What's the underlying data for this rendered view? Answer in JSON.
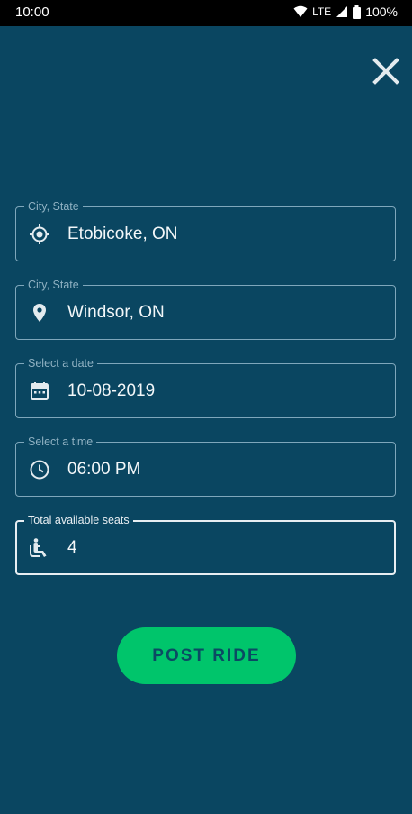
{
  "status_bar": {
    "time": "10:00",
    "network": "LTE",
    "battery": "100%"
  },
  "form": {
    "fields": [
      {
        "label": "City, State",
        "value": "Etobicoke, ON",
        "icon": "my-location-icon"
      },
      {
        "label": "City, State",
        "value": "Windsor, ON",
        "icon": "location-pin-icon"
      },
      {
        "label": "Select a date",
        "value": "10-08-2019",
        "icon": "calendar-icon"
      },
      {
        "label": "Select a time",
        "value": "06:00 PM",
        "icon": "clock-icon"
      },
      {
        "label": "Total available seats",
        "value": "4",
        "icon": "seat-icon"
      }
    ],
    "submit_label": "POST RIDE"
  },
  "colors": {
    "background": "#0a4661",
    "accent": "#00c56b",
    "border": "#7fa7bb",
    "text": "#f3f7f9"
  }
}
